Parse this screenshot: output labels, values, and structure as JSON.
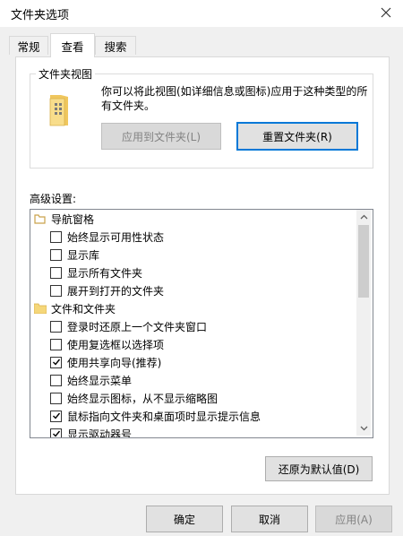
{
  "window": {
    "title": "文件夹选项"
  },
  "tabs": [
    {
      "label": "常规"
    },
    {
      "label": "查看"
    },
    {
      "label": "搜索"
    }
  ],
  "folder_view": {
    "group_label": "文件夹视图",
    "description": "你可以将此视图(如详细信息或图标)应用于这种类型的所有文件夹。",
    "apply_button": "应用到文件夹(L)",
    "reset_button": "重置文件夹(R)"
  },
  "advanced": {
    "label": "高级设置:",
    "items": [
      {
        "type": "folder",
        "label": "导航窗格",
        "icon": "navigation-pane-icon"
      },
      {
        "type": "checkbox",
        "label": "始终显示可用性状态",
        "checked": false
      },
      {
        "type": "checkbox",
        "label": "显示库",
        "checked": false
      },
      {
        "type": "checkbox",
        "label": "显示所有文件夹",
        "checked": false
      },
      {
        "type": "checkbox",
        "label": "展开到打开的文件夹",
        "checked": false
      },
      {
        "type": "folder",
        "label": "文件和文件夹",
        "icon": "folder-icon"
      },
      {
        "type": "checkbox",
        "label": "登录时还原上一个文件夹窗口",
        "checked": false
      },
      {
        "type": "checkbox",
        "label": "使用复选框以选择项",
        "checked": false
      },
      {
        "type": "checkbox",
        "label": "使用共享向导(推荐)",
        "checked": true
      },
      {
        "type": "checkbox",
        "label": "始终显示菜单",
        "checked": false
      },
      {
        "type": "checkbox",
        "label": "始终显示图标，从不显示缩略图",
        "checked": false
      },
      {
        "type": "checkbox",
        "label": "鼠标指向文件夹和桌面项时显示提示信息",
        "checked": true
      },
      {
        "type": "checkbox",
        "label": "显示驱动器号",
        "checked": true
      }
    ]
  },
  "restore_defaults_button": "还原为默认值(D)",
  "footer": {
    "ok": "确定",
    "cancel": "取消",
    "apply": "应用(A)"
  },
  "colors": {
    "accent": "#0078d7",
    "folder": "#f5d77a"
  }
}
